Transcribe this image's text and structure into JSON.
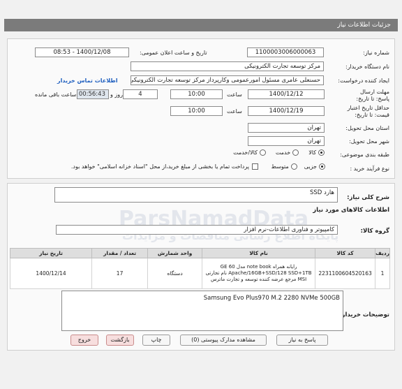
{
  "titlebar": {
    "title": "جزئیات اطلاعات نیاز"
  },
  "form": {
    "need_number": {
      "label": "شماره نیاز:",
      "value": "1100003006000063"
    },
    "announce_datetime": {
      "label": "تاریخ و ساعت اعلان عمومی:",
      "value": "1400/12/08 - 08:53"
    },
    "buyer_device": {
      "label": "نام دستگاه خریدار:",
      "value": "مرکز توسعه تجارت الکترونیکی"
    },
    "request_creator": {
      "label": "ایجاد کننده درخواست:",
      "value": "حسنعلی عامری مسئول امورعمومی وکارپرداز مرکز توسعه تجارت الکترونیکی",
      "link": "اطلاعات تماس خریدار"
    },
    "reply_deadline": {
      "label": "مهلت ارسال پاسخ: تا تاریخ:",
      "date": "1400/12/12",
      "time_label": "ساعت",
      "time": "10:00",
      "days": "4",
      "days_label": "روز و",
      "remaining": "00:56:43",
      "remaining_label": "ساعت باقی مانده"
    },
    "price_validity": {
      "label": "حداقل تاریخ اعتبار قیمت: تا تاریخ:",
      "date": "1400/12/19",
      "time_label": "ساعت",
      "time": "10:00"
    },
    "delivery_province": {
      "label": "استان محل تحویل:",
      "value": "تهران"
    },
    "delivery_city": {
      "label": "شهر محل تحویل:",
      "value": "تهران"
    },
    "category": {
      "label": "طبقه بندی موضوعی:",
      "options": [
        "کالا",
        "خدمت",
        "کالا/خدمت"
      ],
      "selected": "کالا"
    },
    "purchase_process": {
      "label": "نوع فرآیند خرید :",
      "options": [
        "جزیی",
        "متوسط"
      ],
      "selected": "جزیی",
      "note": "پرداخت تمام یا بخشی از مبلغ خرید،از محل \"اسناد خزانه اسلامی\" خواهد بود."
    }
  },
  "summary": {
    "label": "شرح کلی نیاز:",
    "value": "هارد SSD"
  },
  "goods_info": {
    "title": "اطلاعات کالاهای مورد نیاز"
  },
  "group": {
    "label": "گروه کالا:",
    "value": "کامپیوتر و فناوری اطلاعات-نرم افزار"
  },
  "table": {
    "headers": [
      "ردیف",
      "کد کالا",
      "نام کالا",
      "واحد شمارش",
      "تعداد / مقدار",
      "تاریخ نیاز"
    ],
    "rows": [
      {
        "row": "1",
        "code": "2231100604520163",
        "name": "رایانه همراه note book مدل GE 60 Apache/16GB+SSD/128 SSD+1TB نام تجارتی MSI مرجع عرضه کننده توسعه و تجارت ماترس",
        "unit": "دستگاه",
        "qty": "17",
        "date": "1400/12/14"
      }
    ]
  },
  "buyer_notes": {
    "label": "توضیحات خریدار:",
    "value": "Samsung Evo Plus970 M.2 2280 NVMe 500GB"
  },
  "buttons": {
    "reply": "پاسخ به نیاز",
    "attachments": "مشاهده مدارک پیوستی (0)",
    "print": "چاپ",
    "back": "بازگشت",
    "exit": "خروج"
  },
  "watermark": {
    "text": "ParsNamadData",
    "sub": "پایگاه اطلاع رسانی مناقصات و مزایدات"
  }
}
